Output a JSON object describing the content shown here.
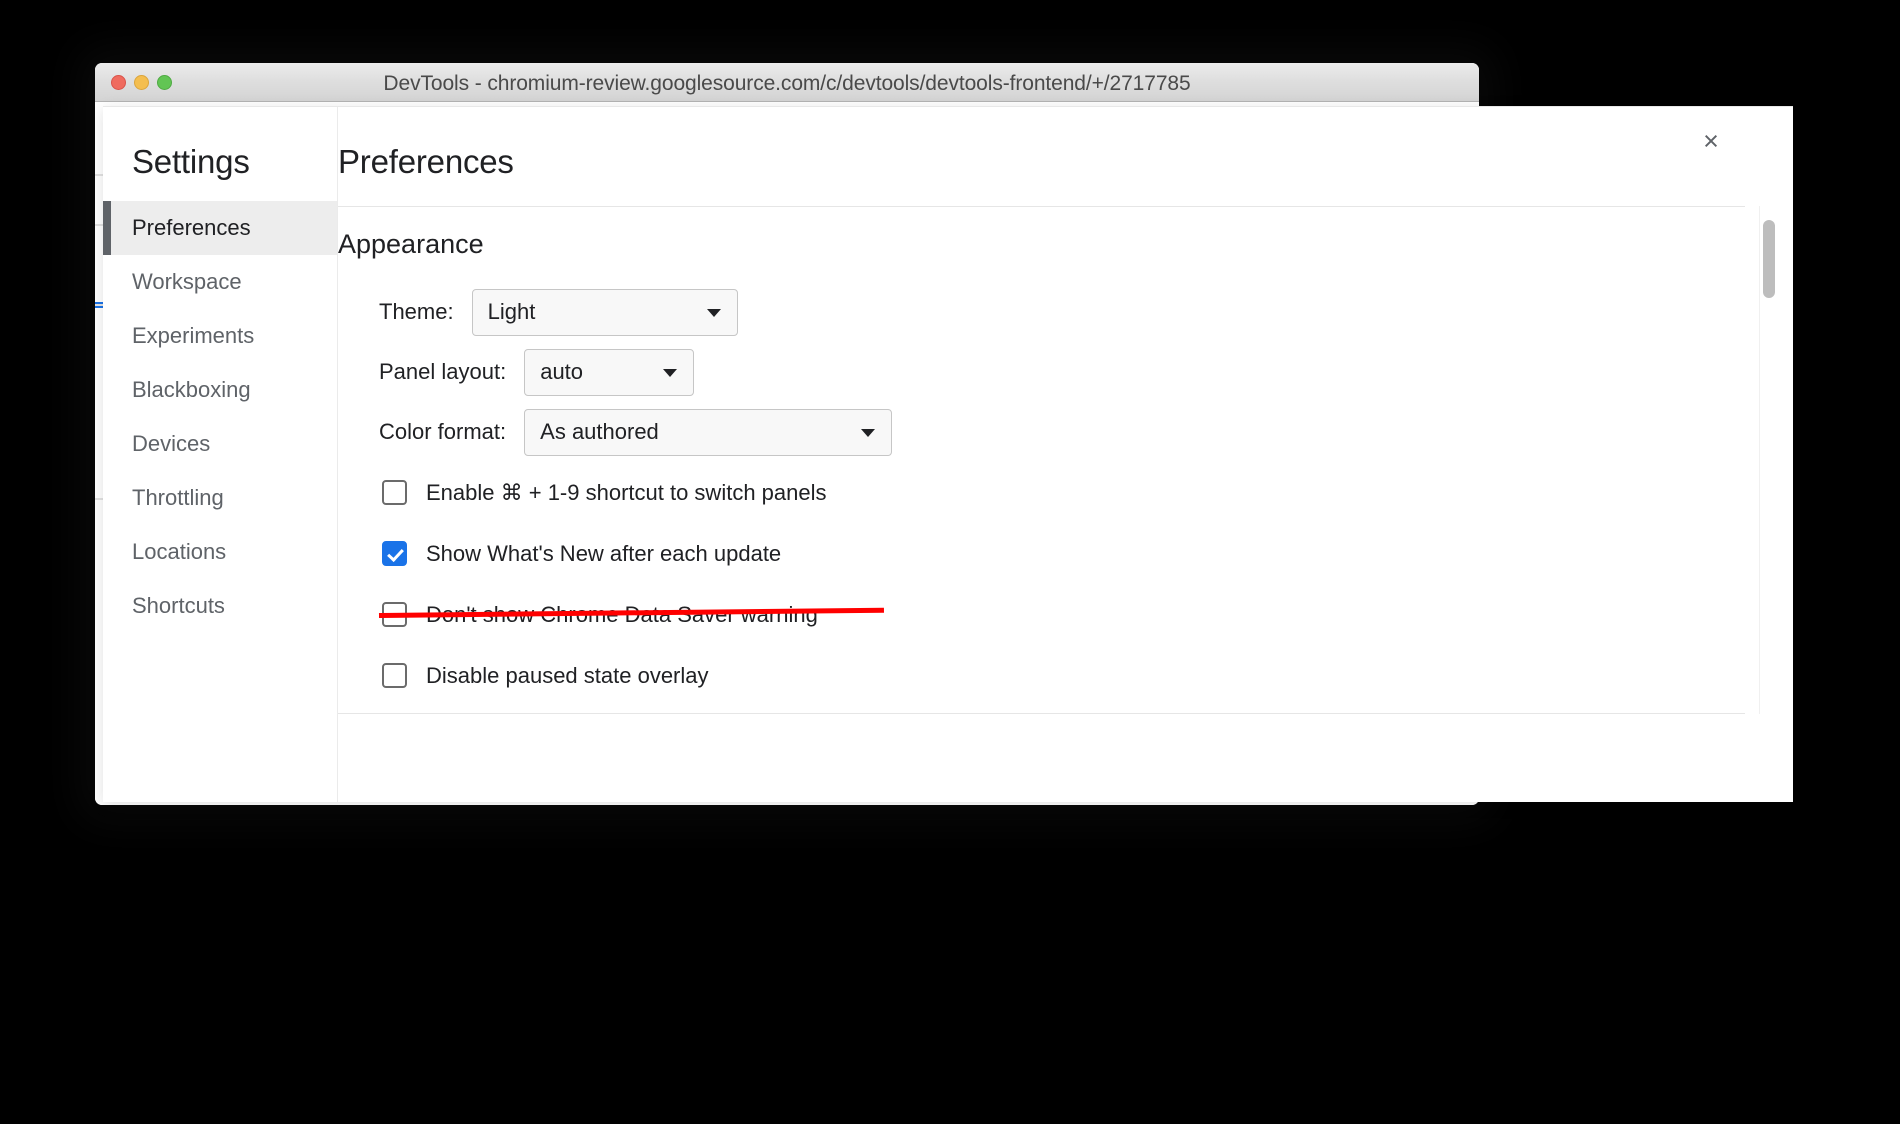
{
  "window": {
    "title": "DevTools - chromium-review.googlesource.com/c/devtools/devtools-frontend/+/2717785",
    "traffic_lights": {
      "close_label": "close",
      "minimize_label": "minimize",
      "maximize_label": "maximize"
    }
  },
  "settings": {
    "close_glyph": "×",
    "sidebar": {
      "title": "Settings",
      "items": [
        {
          "label": "Preferences",
          "selected": true
        },
        {
          "label": "Workspace",
          "selected": false
        },
        {
          "label": "Experiments",
          "selected": false
        },
        {
          "label": "Blackboxing",
          "selected": false
        },
        {
          "label": "Devices",
          "selected": false
        },
        {
          "label": "Throttling",
          "selected": false
        },
        {
          "label": "Locations",
          "selected": false
        },
        {
          "label": "Shortcuts",
          "selected": false
        }
      ]
    },
    "main": {
      "title": "Preferences",
      "section": {
        "heading": "Appearance",
        "selects": [
          {
            "label": "Theme:",
            "value": "Light"
          },
          {
            "label": "Panel layout:",
            "value": "auto"
          },
          {
            "label": "Color format:",
            "value": "As authored"
          }
        ],
        "checkboxes": [
          {
            "label": "Enable ⌘ + 1-9 shortcut to switch panels",
            "checked": false,
            "struck": false
          },
          {
            "label": "Show What's New after each update",
            "checked": true,
            "struck": false
          },
          {
            "label": "Don't show Chrome Data Saver warning",
            "checked": false,
            "struck": true
          },
          {
            "label": "Disable paused state overlay",
            "checked": false,
            "struck": false
          }
        ]
      }
    }
  },
  "colors": {
    "accent": "#1a73e8",
    "strikethrough": "#ff0000",
    "selected_item_bg": "#ededed",
    "selected_item_bar": "#5f6368",
    "text_primary": "#202124",
    "text_secondary": "#5f6368"
  }
}
